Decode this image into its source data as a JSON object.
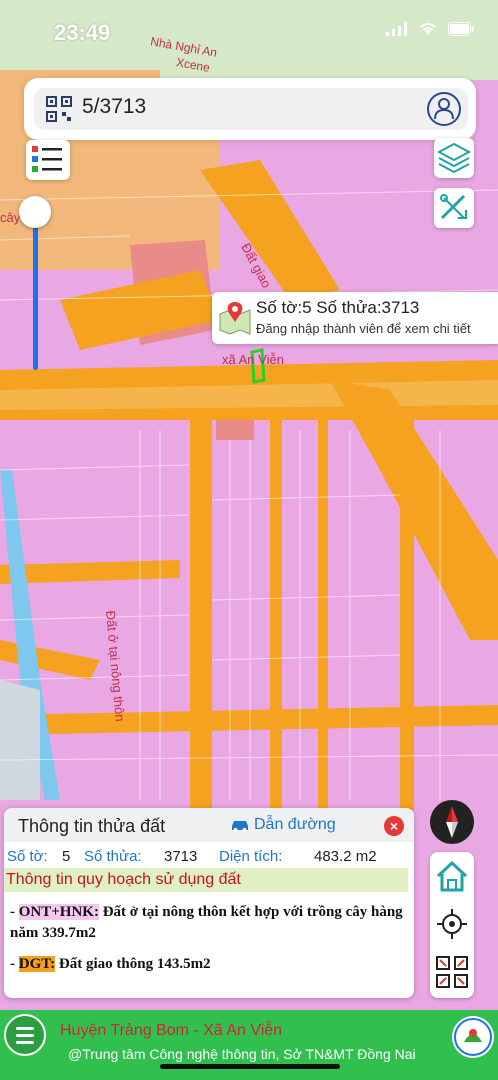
{
  "status_bar": {
    "time": "23:49"
  },
  "search": {
    "value": "5/3713"
  },
  "map": {
    "labels": {
      "poi_top": "Nhà Nghỉ An",
      "poi_top2": "Xcene",
      "left_label": "cây nằm",
      "road_label": "Đất giao",
      "area_label": "Đất ở tại nông thôn",
      "commune": "xã An Viễn"
    },
    "colors": {
      "residential": "#e9a8e3",
      "road": "#f4a21f",
      "agriculture": "#f2b77a",
      "water": "#b6d9f2",
      "special": "#e98b88"
    }
  },
  "popup": {
    "title": "Số tờ:5 Số thửa:3713",
    "subtitle": "Đăng nhập thành viên để xem chi tiết"
  },
  "info_panel": {
    "title": "Thông tin thửa đất",
    "route_label": "Dẫn đường",
    "sheet_label": "Số tờ:",
    "sheet_value": "5",
    "parcel_label": "Số thửa:",
    "parcel_value": "3713",
    "area_label": "Diện tích:",
    "area_value": "483.2 m2",
    "plan_heading": "Thông tin quy hoạch sử dụng đất",
    "plans": [
      {
        "prefix": "- ",
        "code": "ONT+HNK:",
        "text": " Đất ở tại nông thôn kết hợp với trồng cây hàng năm 339.7m2"
      },
      {
        "prefix": "- ",
        "code": "DGT:",
        "text": " Đất giao thông 143.5m2"
      }
    ]
  },
  "footer": {
    "location": "Huyện Trảng Bom - Xã An Viễn",
    "credit": "@Trung tâm Công nghệ thông tin, Sở TN&MT Đồng Nai"
  }
}
